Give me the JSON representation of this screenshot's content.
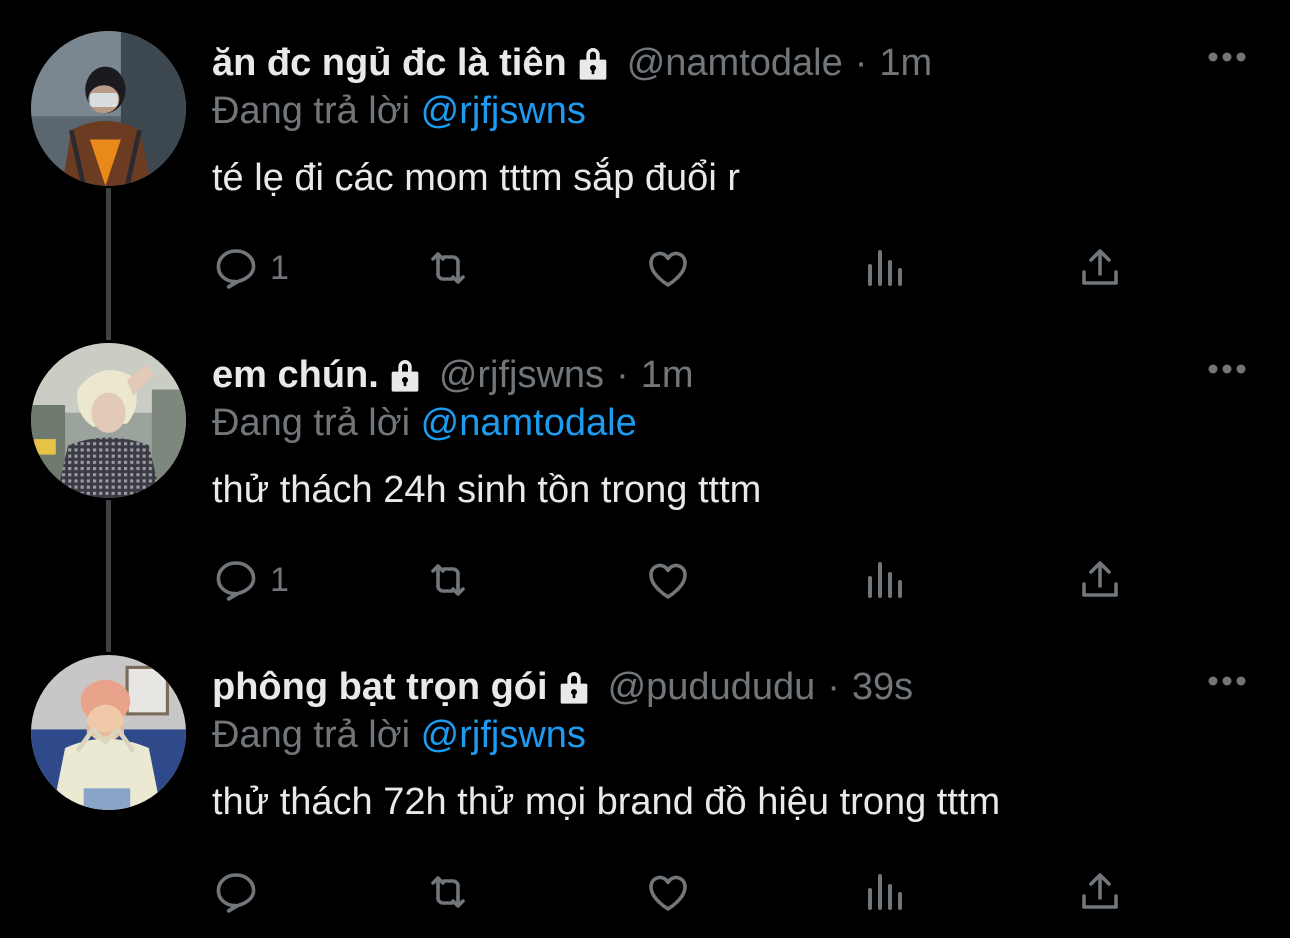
{
  "colors": {
    "background": "#000000",
    "primary_text": "#e7e9ea",
    "secondary_text": "#71767b",
    "mention": "#1d9bf0",
    "thread_line": "#3e4144"
  },
  "tweets": [
    {
      "display_name": "ăn đc ngủ đc là tiên",
      "protected_icon": "lock-icon",
      "handle": "@namtodale",
      "separator": "·",
      "time": "1m",
      "reply_prefix": "Đang trả lời",
      "reply_to": "@rjfjswns",
      "text": "té lẹ đi các mom tttm sắp đuổi r",
      "reply_count": "1"
    },
    {
      "display_name": "em chún.",
      "protected_icon": "lock-icon",
      "handle": "@rjfjswns",
      "separator": "·",
      "time": "1m",
      "reply_prefix": "Đang trả lời",
      "reply_to": "@namtodale",
      "text": "thử thách 24h sinh tồn trong tttm",
      "reply_count": "1"
    },
    {
      "display_name": "phông bạt trọn gói",
      "protected_icon": "lock-icon",
      "handle": "@pudududu",
      "separator": "·",
      "time": "39s",
      "reply_prefix": "Đang trả lời",
      "reply_to": "@rjfjswns",
      "text": "thử thách 72h thử mọi brand đồ hiệu trong tttm",
      "reply_count": ""
    }
  ],
  "action_icons": [
    "reply-icon",
    "retweet-icon",
    "like-icon",
    "views-icon",
    "share-icon"
  ]
}
